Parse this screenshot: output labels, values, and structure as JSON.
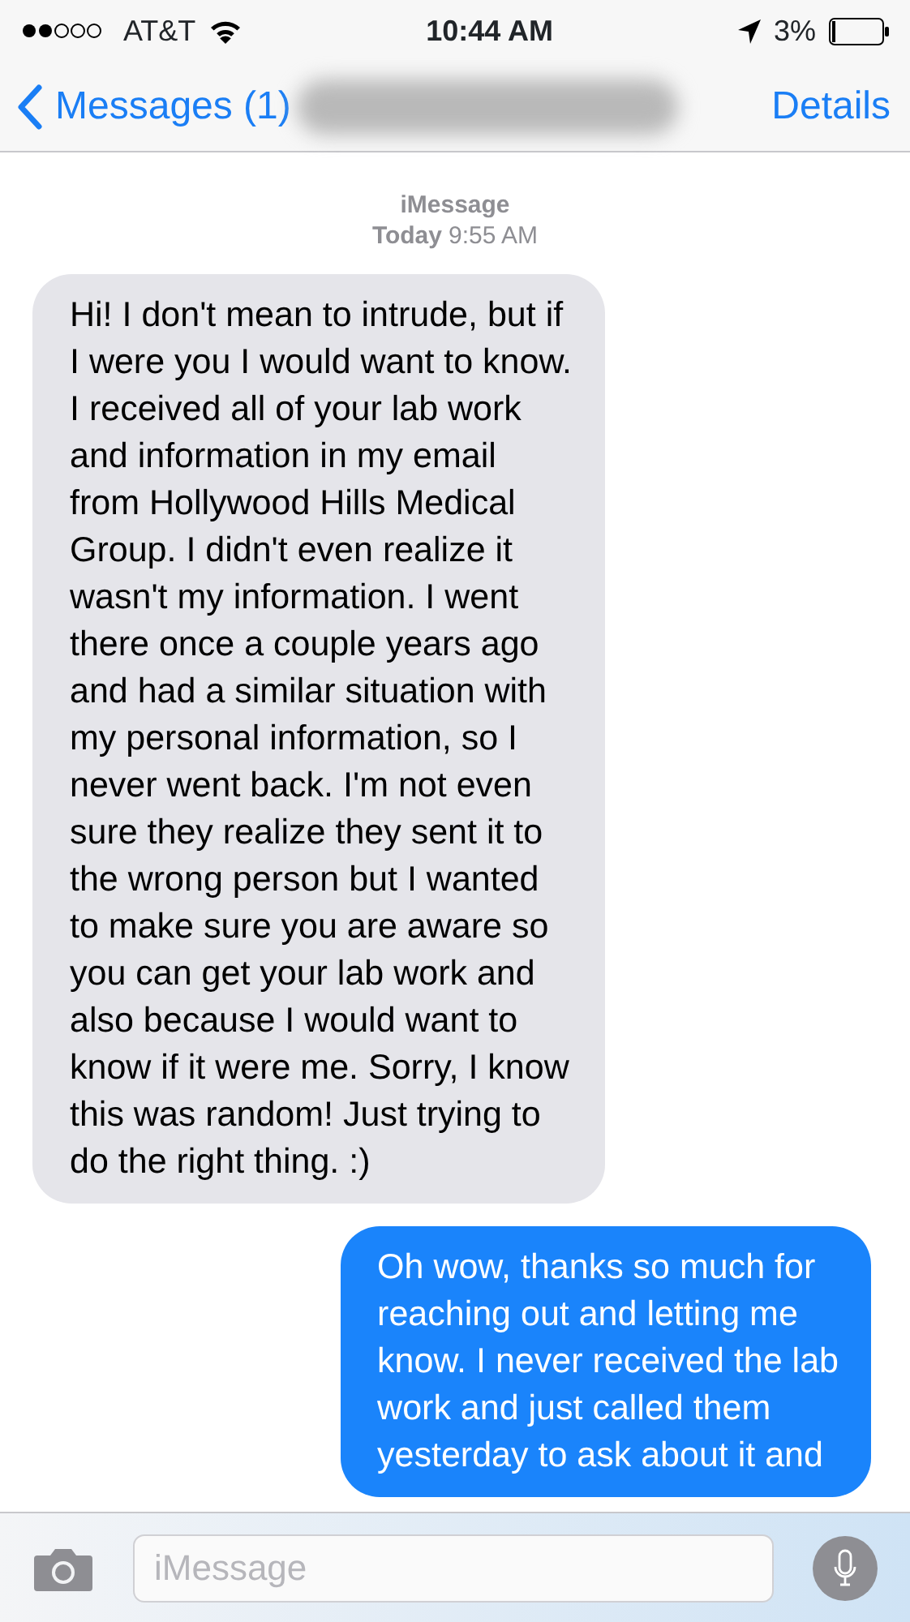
{
  "status_bar": {
    "carrier": "AT&T",
    "time": "10:44 AM",
    "battery": "3%"
  },
  "nav": {
    "back": "Messages (1)",
    "details": "Details"
  },
  "header": {
    "service": "iMessage",
    "day": "Today",
    "time": "9:55 AM"
  },
  "messages": [
    {
      "kind": "received",
      "text": "Hi! I don't mean to intrude, but if\nI were you I would want to know.\nI received all of your lab work\nand information in my email\nfrom Hollywood Hills Medical\nGroup. I didn't even realize it\nwasn't my information. I went\nthere once a couple years ago\nand had a similar situation with\nmy personal information, so I\nnever went back. I'm not even\nsure they realize they sent it to\nthe wrong person but I wanted\nto make sure you are aware so\nyou can get your lab work and\nalso because I would want to\nknow if it were me. Sorry, I know\nthis was random! Just trying to\ndo the right thing. :)"
    },
    {
      "kind": "sent",
      "text": "Oh wow, thanks so much for\nreaching out and letting me\nknow. I never received the lab\nwork and just called them\nyesterday to ask about it and"
    }
  ],
  "composer": {
    "placeholder": "iMessage"
  }
}
